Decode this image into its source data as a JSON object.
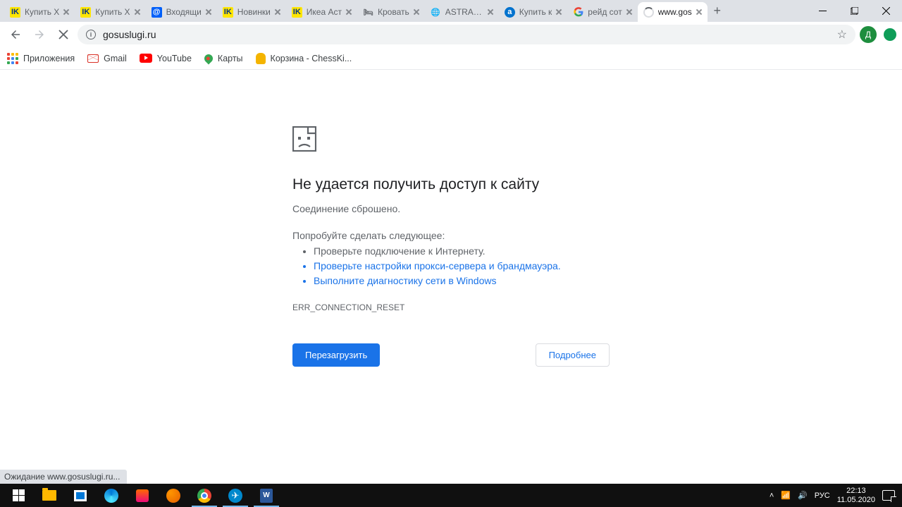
{
  "tabs": [
    {
      "label": "Купить X"
    },
    {
      "label": "Купить X"
    },
    {
      "label": "Входящи"
    },
    {
      "label": "Новинки"
    },
    {
      "label": "Икеа Аст"
    },
    {
      "label": "Кровать"
    },
    {
      "label": "ASTRAKH"
    },
    {
      "label": "Купить к"
    },
    {
      "label": "рейд сот"
    },
    {
      "label": "www.gos"
    }
  ],
  "omnibox": {
    "url": "gosuslugi.ru"
  },
  "bookmarks": {
    "apps": "Приложения",
    "gmail": "Gmail",
    "youtube": "YouTube",
    "maps": "Карты",
    "chess": "Корзина - ChessKi..."
  },
  "error": {
    "title": "Не удается получить доступ к сайту",
    "sub": "Соединение сброшено.",
    "try": "Попробуйте сделать следующее:",
    "items": [
      "Проверьте подключение к Интернету.",
      "Проверьте настройки прокси-сервера и брандмауэра.",
      "Выполните диагностику сети в Windows"
    ],
    "code": "ERR_CONNECTION_RESET",
    "reload": "Перезагрузить",
    "details": "Подробнее"
  },
  "status_bar": "Ожидание www.gosuslugi.ru...",
  "profile_initial": "Д",
  "tray": {
    "lang": "РУС",
    "time": "22:13",
    "date": "11.05.2020"
  }
}
